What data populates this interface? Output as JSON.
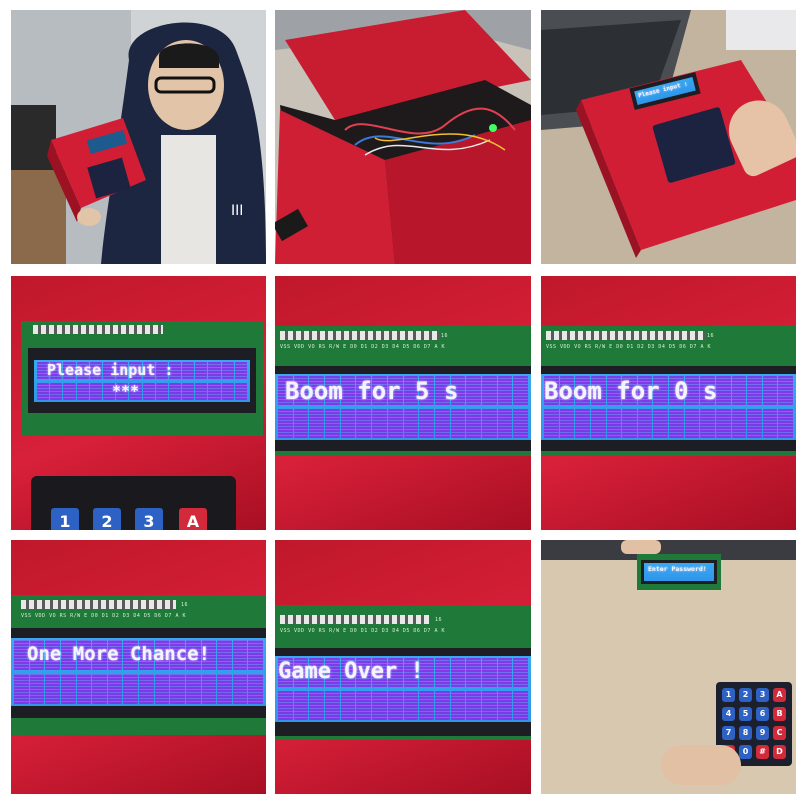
{
  "panels": [
    {
      "lcd_line1": ""
    },
    {
      "lcd_line1": ""
    },
    {
      "lcd_line1": "Please input :"
    },
    {
      "lcd_line1": "Please input :",
      "lcd_line2": "***"
    },
    {
      "lcd_line1": "Boom for 5 s"
    },
    {
      "lcd_line1": "Boom for 0 s"
    },
    {
      "lcd_line1": "One More Chance!"
    },
    {
      "lcd_line1": "Game Over !"
    },
    {
      "lcd_line1": "Enter Password!"
    }
  ],
  "keypad_keys": [
    "1",
    "2",
    "3",
    "A",
    "4",
    "5",
    "6",
    "B",
    "7",
    "8",
    "9",
    "C",
    "*",
    "0",
    "#",
    "D"
  ],
  "pin_label": "VSS VDD VO RS R/W E D0 D1 D2 D3 D4 D5 D6 D7 A K",
  "pin_number": "16",
  "colors": {
    "box_red": "#d21e34",
    "lcd_blue": "#2f96ea",
    "pixel_purple": "#9b3ce8",
    "pcb_green": "#1f7a3a"
  }
}
